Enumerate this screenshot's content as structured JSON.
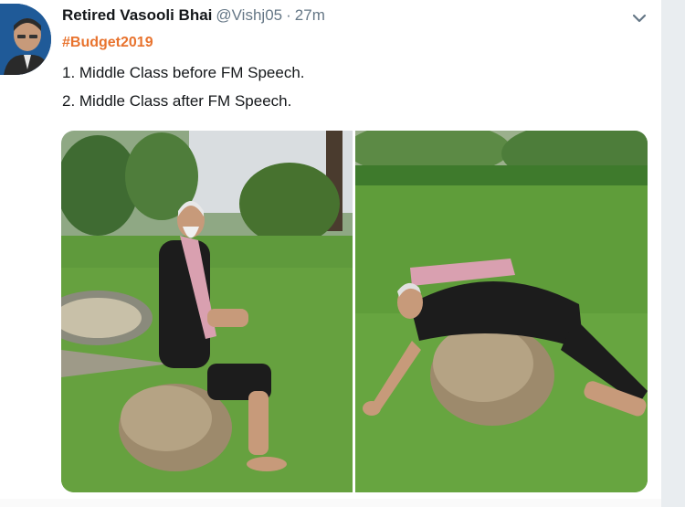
{
  "tweet": {
    "display_name": "Retired Vasooli Bhai",
    "handle": "@Vishj05",
    "separator": "·",
    "timestamp": "27m",
    "hashtag": "#Budget2019",
    "lines": [
      "1. Middle Class before FM Speech.",
      "2. Middle Class after FM Speech."
    ],
    "caret_icon": "chevron-down-icon"
  },
  "colors": {
    "hashtag": "#e8732e",
    "name": "#14171a",
    "muted": "#657786"
  }
}
